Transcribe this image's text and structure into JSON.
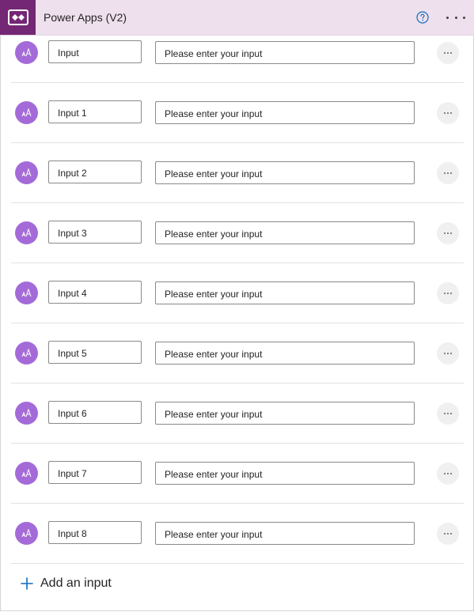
{
  "header": {
    "title": "Power Apps (V2)",
    "logo_icon": "power-apps-icon",
    "help_icon": "help-circle-icon",
    "more_icon": "more-horizontal-icon",
    "brand_color": "#742774",
    "header_bg": "#efe0ee"
  },
  "inputs": [
    {
      "name": "Input",
      "description": "Please enter your input",
      "type_icon": "text-type-icon"
    },
    {
      "name": "Input 1",
      "description": "Please enter your input",
      "type_icon": "text-type-icon"
    },
    {
      "name": "Input 2",
      "description": "Please enter your input",
      "type_icon": "text-type-icon"
    },
    {
      "name": "Input 3",
      "description": "Please enter your input",
      "type_icon": "text-type-icon"
    },
    {
      "name": "Input 4",
      "description": "Please enter your input",
      "type_icon": "text-type-icon"
    },
    {
      "name": "Input 5",
      "description": "Please enter your input",
      "type_icon": "text-type-icon"
    },
    {
      "name": "Input 6",
      "description": "Please enter your input",
      "type_icon": "text-type-icon"
    },
    {
      "name": "Input 7",
      "description": "Please enter your input",
      "type_icon": "text-type-icon"
    },
    {
      "name": "Input 8",
      "description": "Please enter your input",
      "type_icon": "text-type-icon"
    }
  ],
  "add_input": {
    "label": "Add an input",
    "icon": "plus-icon",
    "accent": "#0f6cbd"
  },
  "avatar_color": "#a46bd8"
}
